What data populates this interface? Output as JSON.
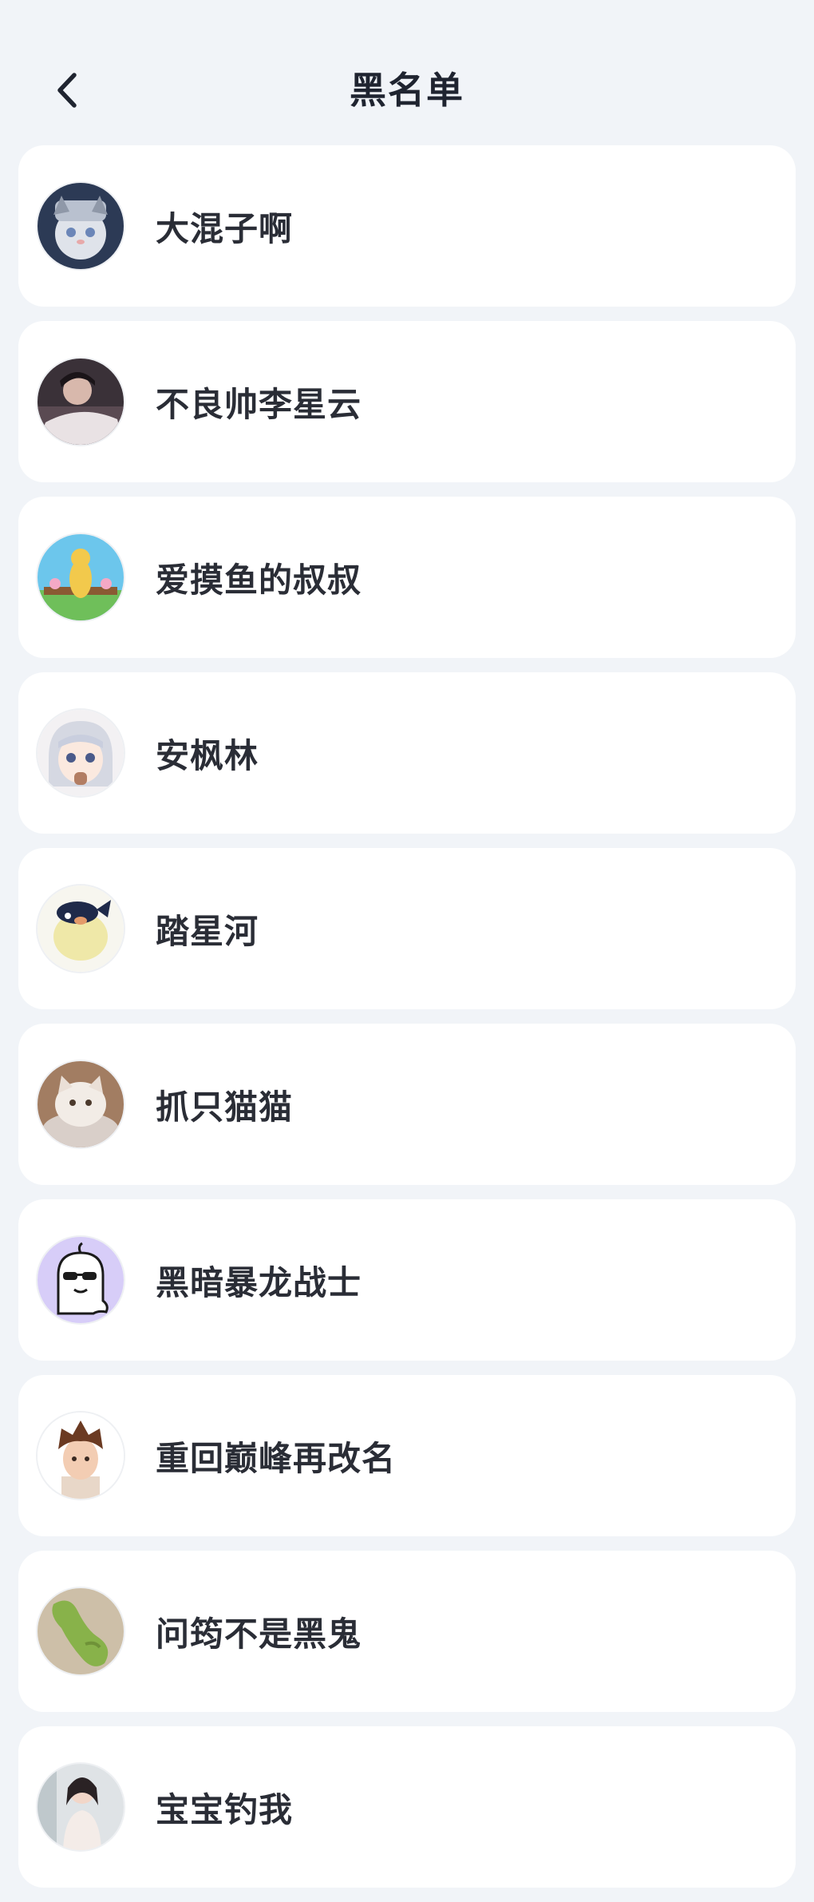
{
  "header": {
    "title": "黑名单",
    "back_icon": "chevron-left-icon"
  },
  "blacklist": [
    {
      "name": "大混子啊",
      "avatar": "cat-avatar"
    },
    {
      "name": "不良帅李星云",
      "avatar": "person-avatar"
    },
    {
      "name": "爱摸鱼的叔叔",
      "avatar": "cartoon-avatar"
    },
    {
      "name": "安枫林",
      "avatar": "anime-girl-avatar"
    },
    {
      "name": "踏星河",
      "avatar": "fish-avatar"
    },
    {
      "name": "抓只猫猫",
      "avatar": "kitten-avatar"
    },
    {
      "name": "黑暗暴龙战士",
      "avatar": "ghost-sunglasses-avatar"
    },
    {
      "name": "重回巅峰再改名",
      "avatar": "boy-3d-avatar"
    },
    {
      "name": "问筠不是黑鬼",
      "avatar": "green-plush-avatar"
    },
    {
      "name": "宝宝钓我",
      "avatar": "girl-photo-avatar"
    }
  ]
}
